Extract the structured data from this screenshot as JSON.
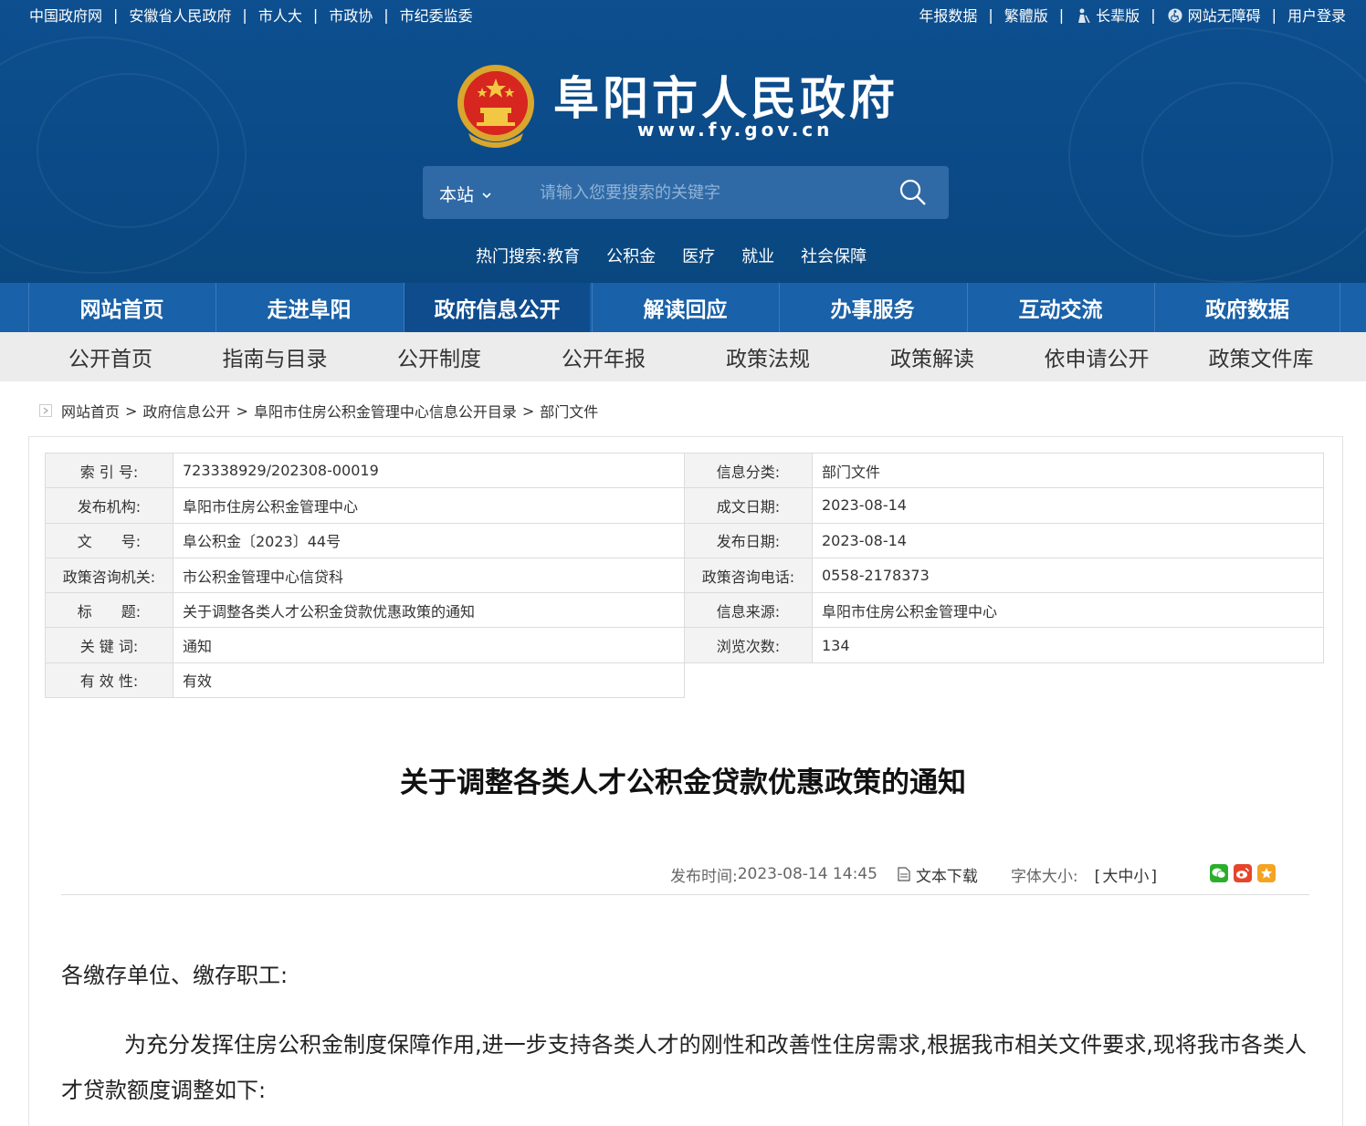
{
  "topbar": {
    "left_links": [
      "中国政府网",
      "安徽省人民政府",
      "市人大",
      "市政协",
      "市纪委监委"
    ],
    "right_links": [
      "年报数据",
      "繁體版",
      "长辈版",
      "网站无障碍",
      "用户登录"
    ],
    "separator": "|"
  },
  "header": {
    "site_title": "阜阳市人民政府",
    "site_url": "www.fy.gov.cn",
    "emblem_icon": "national-emblem-icon"
  },
  "search": {
    "scope": "本站",
    "placeholder": "请输入您要搜索的关键字",
    "hot_label": "热门搜索:",
    "hot_terms": [
      "教育",
      "公积金",
      "医疗",
      "就业",
      "社会保障"
    ]
  },
  "main_nav": {
    "items": [
      "网站首页",
      "走进阜阳",
      "政府信息公开",
      "解读回应",
      "办事服务",
      "互动交流",
      "政府数据"
    ],
    "active": "政府信息公开"
  },
  "sub_nav": {
    "items": [
      "公开首页",
      "指南与目录",
      "公开制度",
      "公开年报",
      "政策法规",
      "政策解读",
      "依申请公开",
      "政策文件库"
    ]
  },
  "breadcrumb": {
    "items": [
      "网站首页",
      "政府信息公开",
      "阜阳市住房公积金管理中心信息公开目录",
      "部门文件"
    ],
    "separator": ">"
  },
  "meta": {
    "rows": [
      {
        "l1": "索 引 号:",
        "v1": "723338929/202308-00019",
        "l2": "信息分类:",
        "v2": "部门文件"
      },
      {
        "l1": "发布机构:",
        "v1": "阜阳市住房公积金管理中心",
        "l2": "成文日期:",
        "v2": "2023-08-14"
      },
      {
        "l1": "文　　号:",
        "v1": "阜公积金〔2023〕44号",
        "l2": "发布日期:",
        "v2": "2023-08-14"
      },
      {
        "l1": "政策咨询机关:",
        "v1": "市公积金管理中心信贷科",
        "l2": "政策咨询电话:",
        "v2": "0558-2178373"
      },
      {
        "l1": "标　　题:",
        "v1": "关于调整各类人才公积金贷款优惠政策的通知",
        "l2": "信息来源:",
        "v2": "阜阳市住房公积金管理中心"
      },
      {
        "l1": "关 键 词:",
        "v1": "通知",
        "l2": "浏览次数:",
        "v2": "134"
      },
      {
        "l1": "有 效 性:",
        "v1": "有效"
      }
    ]
  },
  "article": {
    "title": "关于调整各类人才公积金贷款优惠政策的通知",
    "publish_label": "发布时间:",
    "publish_time": "2023-08-14 14:45",
    "download_label": "文本下载",
    "font_size_label": "字体大小:",
    "font_size_open": "[",
    "font_large": "大",
    "font_medium": "中",
    "font_small": "小",
    "font_size_close": "]",
    "greeting": "各缴存单位、缴存职工:",
    "paragraph": "为充分发挥住房公积金制度保障作用,进一步支持各类人才的刚性和改善性住房需求,根据我市相关文件要求,现将我市各类人才贷款额度调整如下:"
  },
  "colors": {
    "header_bg": "#0d4f8f",
    "nav_bg": "#1961a8",
    "nav_active": "#0e4c8e",
    "subnav_bg": "#ececec",
    "wechat": "#2bae2b",
    "weibo": "#e6452c",
    "star": "#f4a422"
  }
}
